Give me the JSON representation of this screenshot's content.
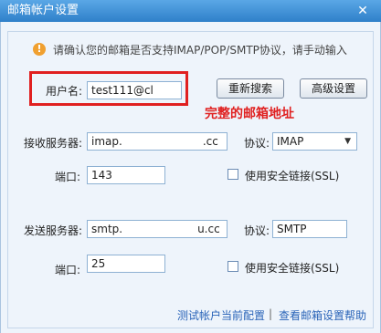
{
  "window": {
    "title": "邮箱帐户设置",
    "close_glyph": "✕"
  },
  "notice": {
    "icon": "warning-icon",
    "icon_glyph": "!",
    "text": "请确认您的邮箱是否支持IMAP/POP/SMTP协议，请手动输入"
  },
  "account": {
    "username_label": "用户名:",
    "username_value": "test111@cl",
    "annotation": "完整的邮箱地址"
  },
  "buttons": {
    "research": "重新搜索",
    "advanced": "高级设置"
  },
  "incoming": {
    "server_label": "接收服务器:",
    "server_value": "imap.",
    "server_suffix": ".cc",
    "protocol_label": "协议:",
    "protocol_value": "IMAP",
    "port_label": "端口:",
    "port_value": "143",
    "ssl_label": "使用安全链接(SSL)"
  },
  "outgoing": {
    "server_label": "发送服务器:",
    "server_value": "smtp.",
    "server_suffix": "u.cc",
    "protocol_label": "协议:",
    "protocol_value": "SMTP",
    "port_label": "端口:",
    "port_value": "25",
    "ssl_label": "使用安全链接(SSL)"
  },
  "footer": {
    "test_link": "测试帐户当前配置",
    "separator": "|",
    "help_link": "查看邮箱设置帮助"
  },
  "colors": {
    "title_bar": "#2f80c9",
    "highlight": "#e02020",
    "link": "#2a64b8"
  }
}
